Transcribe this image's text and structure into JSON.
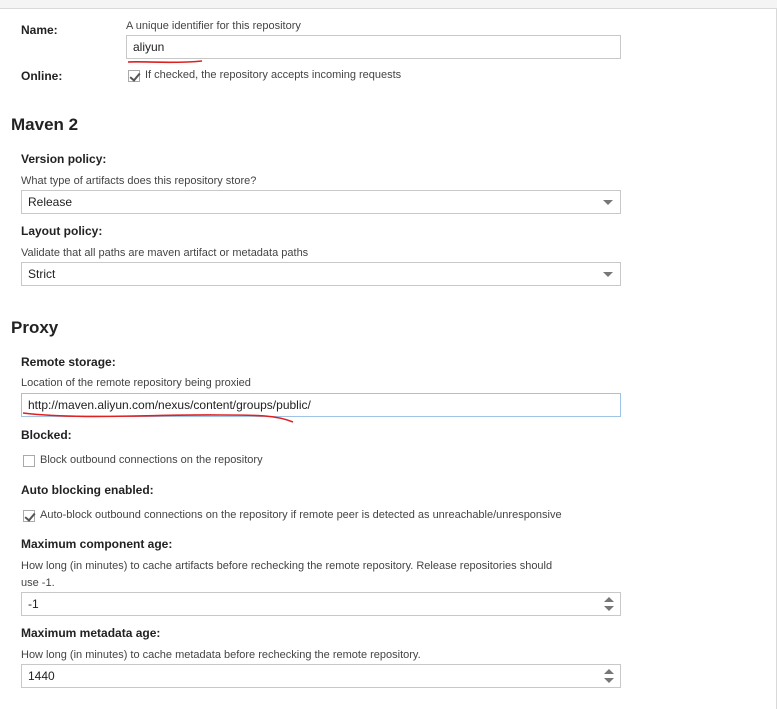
{
  "colors": {
    "annotation": "#e02020",
    "focus_border": "#9fc3e4"
  },
  "name_field": {
    "label": "Name:",
    "help": "A unique identifier for this repository",
    "value": "aliyun"
  },
  "online": {
    "label": "Online:",
    "checked": true,
    "text": "If checked, the repository accepts incoming requests"
  },
  "maven2": {
    "title": "Maven 2",
    "version_policy": {
      "label": "Version policy:",
      "help": "What type of artifacts does this repository store?",
      "value": "Release",
      "icon": "chevron-down-icon"
    },
    "layout_policy": {
      "label": "Layout policy:",
      "help": "Validate that all paths are maven artifact or metadata paths",
      "value": "Strict",
      "icon": "chevron-down-icon"
    }
  },
  "proxy": {
    "title": "Proxy",
    "remote_storage": {
      "label": "Remote storage:",
      "help": "Location of the remote repository being proxied",
      "value": "http://maven.aliyun.com/nexus/content/groups/public/"
    },
    "blocked": {
      "label": "Blocked:",
      "checked": false,
      "text": "Block outbound connections on the repository"
    },
    "auto_blocking": {
      "label": "Auto blocking enabled:",
      "checked": true,
      "text": "Auto-block outbound connections on the repository if remote peer is detected as unreachable/unresponsive"
    },
    "max_component_age": {
      "label": "Maximum component age:",
      "help_line1": "How long (in minutes) to cache artifacts before rechecking the remote repository. Release repositories should",
      "help_line2": "use -1.",
      "value": "-1"
    },
    "max_metadata_age": {
      "label": "Maximum metadata age:",
      "help": "How long (in minutes) to cache metadata before rechecking the remote repository.",
      "value": "1440"
    }
  }
}
